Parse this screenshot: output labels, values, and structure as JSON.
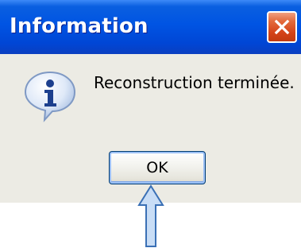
{
  "dialog": {
    "title": "Information",
    "message": "Reconstruction terminée.",
    "ok_label": "OK",
    "icon": "info-icon",
    "close_icon": "close-icon",
    "annotation_icon": "up-arrow-icon"
  },
  "colors": {
    "titlebar": "#0054e3",
    "close_button": "#d44318",
    "body": "#ecebe4",
    "arrow_fill": "#c8ddf6",
    "arrow_stroke": "#3a70b5"
  }
}
